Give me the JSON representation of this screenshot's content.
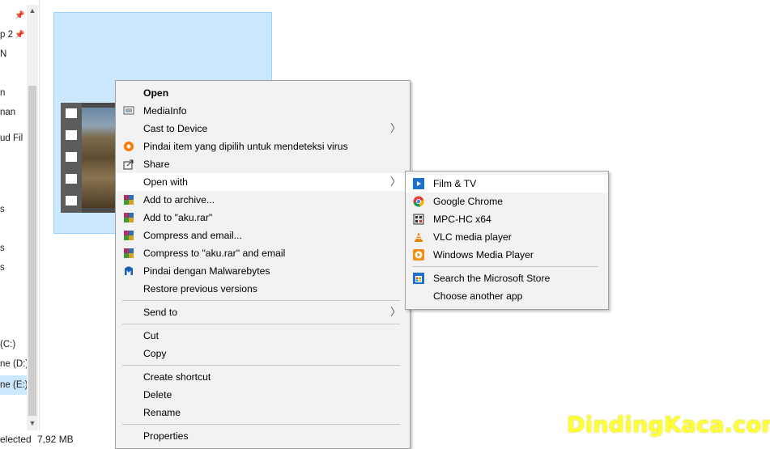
{
  "nav": {
    "items": [
      "p 2",
      "N",
      "n",
      "nan",
      "ud Fil",
      "s",
      "s",
      "s",
      "(C:)",
      "ne (D:)",
      "ne (E:)"
    ]
  },
  "status": {
    "selected": "elected",
    "size": "7,92 MB"
  },
  "context_menu": {
    "items": [
      {
        "label": "Open",
        "icon": "none"
      },
      {
        "label": "MediaInfo",
        "icon": "mediainfo-icon"
      },
      {
        "label": "Cast to Device",
        "icon": "none"
      },
      {
        "label": "Pindai item yang dipilih untuk mendeteksi virus",
        "icon": "avast-icon"
      },
      {
        "label": "Share",
        "icon": "share-icon"
      },
      {
        "label": "Open with",
        "icon": "none"
      },
      {
        "label": "Add to archive...",
        "icon": "winrar-icon"
      },
      {
        "label": "Add to \"aku.rar\"",
        "icon": "winrar-icon"
      },
      {
        "label": "Compress and email...",
        "icon": "winrar-icon"
      },
      {
        "label": "Compress to \"aku.rar\" and email",
        "icon": "winrar-icon"
      },
      {
        "label": "Pindai dengan Malwarebytes",
        "icon": "malwarebytes-icon"
      },
      {
        "label": "Restore previous versions",
        "icon": "none"
      },
      {
        "label": "Send to",
        "icon": "none"
      },
      {
        "label": "Cut",
        "icon": "none"
      },
      {
        "label": "Copy",
        "icon": "none"
      },
      {
        "label": "Create shortcut",
        "icon": "none"
      },
      {
        "label": "Delete",
        "icon": "none"
      },
      {
        "label": "Rename",
        "icon": "none"
      },
      {
        "label": "Properties",
        "icon": "none"
      }
    ]
  },
  "open_with_menu": {
    "items": [
      {
        "label": "Film & TV",
        "icon": "film-tv-icon"
      },
      {
        "label": "Google Chrome",
        "icon": "chrome-icon"
      },
      {
        "label": "MPC-HC x64",
        "icon": "mpc-hc-icon"
      },
      {
        "label": "VLC media player",
        "icon": "vlc-icon"
      },
      {
        "label": "Windows Media Player",
        "icon": "wmp-icon"
      },
      {
        "label": "Search the Microsoft Store",
        "icon": "store-icon"
      },
      {
        "label": "Choose another app",
        "icon": "none"
      }
    ]
  },
  "watermark": "DindingKaca.com",
  "colors": {
    "selection": "#cce8ff",
    "menu_bg": "#f2f2f2",
    "watermark": "#ffff33"
  }
}
